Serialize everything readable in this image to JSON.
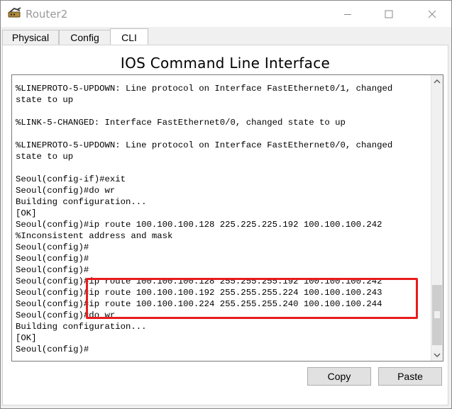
{
  "window": {
    "title": "Router2",
    "minimize_glyph": "—",
    "maximize_glyph": "☐",
    "close_glyph": "✕"
  },
  "tabs": [
    {
      "label": "Physical",
      "active": false
    },
    {
      "label": "Config",
      "active": false
    },
    {
      "label": "CLI",
      "active": true
    }
  ],
  "cli": {
    "heading": "IOS Command Line Interface",
    "lines": [
      "%LINEPROTO-5-UPDOWN: Line protocol on Interface FastEthernet0/1, changed",
      "state to up",
      "",
      "%LINK-5-CHANGED: Interface FastEthernet0/0, changed state to up",
      "",
      "%LINEPROTO-5-UPDOWN: Line protocol on Interface FastEthernet0/0, changed",
      "state to up",
      "",
      "Seoul(config-if)#exit",
      "Seoul(config)#do wr",
      "Building configuration...",
      "[OK]",
      "Seoul(config)#ip route 100.100.100.128 225.225.225.192 100.100.100.242",
      "%Inconsistent address and mask",
      "Seoul(config)#",
      "Seoul(config)#",
      "Seoul(config)#",
      "Seoul(config)#ip route 100.100.100.128 255.255.255.192 100.100.100.242",
      "Seoul(config)#ip route 100.100.100.192 255.255.255.224 100.100.100.243",
      "Seoul(config)#ip route 100.100.100.224 255.255.255.240 100.100.100.244",
      "Seoul(config)#do wr",
      "Building configuration...",
      "[OK]",
      "Seoul(config)#"
    ],
    "highlight_color": "#e81d1d"
  },
  "buttons": {
    "copy_label": "Copy",
    "paste_label": "Paste"
  }
}
